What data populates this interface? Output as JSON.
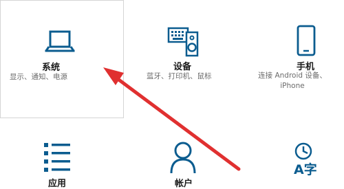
{
  "tiles": {
    "system": {
      "title": "系统",
      "desc": "显示、通知、电源",
      "icon": "laptop-icon"
    },
    "devices": {
      "title": "设备",
      "desc": "蓝牙、打印机、鼠标",
      "icon": "keyboard-speaker-icon"
    },
    "phone": {
      "title": "手机",
      "desc_line1": "连接 Android 设备、",
      "desc_line2": "iPhone",
      "icon": "phone-icon"
    },
    "apps": {
      "title": "应用",
      "icon": "list-icon"
    },
    "accounts": {
      "title": "帐户",
      "icon": "person-icon"
    },
    "time_language": {
      "icon": "time-language-icon",
      "glyph": "A字"
    }
  },
  "colors": {
    "accent": "#0b5c8f",
    "arrow": "#e03030",
    "border": "#d4d4d4"
  }
}
